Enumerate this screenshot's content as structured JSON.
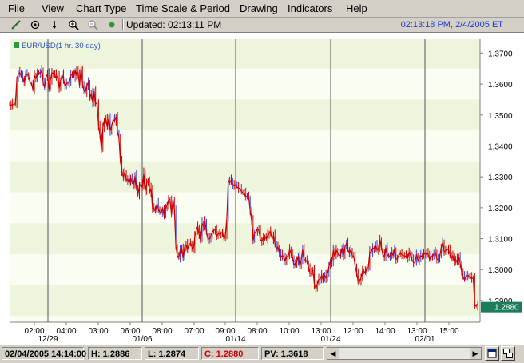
{
  "menu": {
    "items": [
      "File",
      "View",
      "Chart Type",
      "Time Scale & Period",
      "Drawing",
      "Indicators",
      "Help"
    ]
  },
  "toolbar": {
    "tools": [
      "draw-line-icon",
      "crosshair-icon",
      "arrow-down-icon",
      "zoom-in-icon",
      "zoom-out-icon",
      "green-dot-icon"
    ],
    "updated_text": "Updated: 02:13:11 PM",
    "clock_text": "02:13:18 PM, 2/4/2005 ET"
  },
  "chart_data": {
    "type": "line",
    "legend_label": "EUR/USD(1 hr. 30 day)",
    "series_color": "#cc0000",
    "wick_color": "#3a3aee",
    "ylim": [
      1.283,
      1.3745
    ],
    "yticks": [
      "1.3700",
      "1.3600",
      "1.3500",
      "1.3400",
      "1.3300",
      "1.3200",
      "1.3100",
      "1.3000",
      "1.2900"
    ],
    "last_price_label": "1.2880",
    "last_price": 1.288,
    "time_ticks": [
      "02:00",
      "04:00",
      "03:00",
      "06:00",
      "08:00",
      "07:00",
      "09:00",
      "08:00",
      "10:00",
      "13:00",
      "12:00",
      "14:00",
      "13:00",
      "15:00"
    ],
    "date_ticks": [
      "12/29",
      "01/06",
      "01/14",
      "01/24",
      "02/01"
    ],
    "series": [
      {
        "values": [
          1.3535,
          1.3531,
          1.3534,
          1.3533,
          1.3538,
          1.3618,
          1.3632,
          1.3637,
          1.3627,
          1.362,
          1.3605,
          1.3631,
          1.3629,
          1.3629,
          1.3603,
          1.3602,
          1.3582,
          1.3628,
          1.3617,
          1.3635,
          1.3638,
          1.3634,
          1.3644,
          1.3605,
          1.3588,
          1.3623,
          1.3633,
          1.3584,
          1.3613,
          1.3637,
          1.3634,
          1.363,
          1.3617,
          1.3627,
          1.3585,
          1.3613,
          1.363,
          1.3616,
          1.3593,
          1.3602,
          1.3603,
          1.3605,
          1.3628,
          1.3632,
          1.3624,
          1.3645,
          1.3626,
          1.3639,
          1.3593,
          1.3654,
          1.3599,
          1.3579,
          1.3574,
          1.3594,
          1.3607,
          1.3555,
          1.357,
          1.3539,
          1.3577,
          1.3535,
          1.3539,
          1.3464,
          1.3435,
          1.3387,
          1.346,
          1.3485,
          1.3487,
          1.3461,
          1.3491,
          1.3448,
          1.3465,
          1.3485,
          1.3481,
          1.3495,
          1.3446,
          1.3426,
          1.335,
          1.3318,
          1.3299,
          1.3316,
          1.3288,
          1.3293,
          1.328,
          1.3297,
          1.3283,
          1.3275,
          1.3303,
          1.3264,
          1.3242,
          1.3268,
          1.3277,
          1.3264,
          1.3312,
          1.3254,
          1.3279,
          1.3289,
          1.325,
          1.3263,
          1.3196,
          1.32,
          1.3187,
          1.3213,
          1.3195,
          1.3186,
          1.3184,
          1.3197,
          1.3175,
          1.3195,
          1.3209,
          1.3226,
          1.3227,
          1.3177,
          1.3226,
          1.3192,
          1.3076,
          1.3045,
          1.3038,
          1.3063,
          1.3069,
          1.3037,
          1.3074,
          1.3081,
          1.3065,
          1.3081,
          1.3085,
          1.3073,
          1.3064,
          1.3106,
          1.3128,
          1.314,
          1.3111,
          1.3094,
          1.315,
          1.3139,
          1.3158,
          1.3121,
          1.3099,
          1.3099,
          1.3108,
          1.3121,
          1.3127,
          1.3128,
          1.3108,
          1.3115,
          1.3117,
          1.3116,
          1.3121,
          1.3098,
          1.3113,
          1.3167,
          1.3289,
          1.3281,
          1.3289,
          1.3275,
          1.327,
          1.3275,
          1.3266,
          1.3264,
          1.3262,
          1.3252,
          1.3247,
          1.3247,
          1.3236,
          1.3237,
          1.3233,
          1.3191,
          1.3158,
          1.3092,
          1.3119,
          1.3122,
          1.3132,
          1.3125,
          1.3097,
          1.3091,
          1.3103,
          1.3107,
          1.3099,
          1.3112,
          1.3117,
          1.3124,
          1.3098,
          1.3111,
          1.3084,
          1.3065,
          1.3075,
          1.3054,
          1.3039,
          1.3046,
          1.3039,
          1.3028,
          1.3043,
          1.304,
          1.3065,
          1.3052,
          1.304,
          1.3013,
          1.3021,
          1.3025,
          1.3045,
          1.3009,
          1.3033,
          1.3066,
          1.3032,
          1.3031,
          1.3024,
          1.3008,
          1.2988,
          1.2988,
          1.2999,
          1.2953,
          1.2938,
          1.2954,
          1.2968,
          1.2968,
          1.2983,
          1.2966,
          1.2981,
          1.2972,
          1.2986,
          1.3009,
          1.3029,
          1.3023,
          1.3063,
          1.304,
          1.3064,
          1.3054,
          1.3044,
          1.3048,
          1.307,
          1.3046,
          1.3074,
          1.3084,
          1.3064,
          1.3054,
          1.3064,
          1.3045,
          1.3043,
          1.3011,
          1.2989,
          1.2961,
          1.2963,
          1.2974,
          1.2994,
          1.2995,
          1.2989,
          1.3006,
          1.3006,
          1.3057,
          1.3056,
          1.307,
          1.3067,
          1.3078,
          1.3062,
          1.307,
          1.3097,
          1.3071,
          1.3048,
          1.3041,
          1.3072,
          1.3049,
          1.3043,
          1.3045,
          1.3055,
          1.3045,
          1.3066,
          1.3034,
          1.3036,
          1.3047,
          1.3053,
          1.3049,
          1.3045,
          1.3044,
          1.3042,
          1.3038,
          1.3056,
          1.3046,
          1.3031,
          1.3023,
          1.3021,
          1.3049,
          1.3029,
          1.3036,
          1.3045,
          1.3041,
          1.305,
          1.3053,
          1.3048,
          1.3052,
          1.3031,
          1.3045,
          1.3042,
          1.3052,
          1.3055,
          1.3035,
          1.3032,
          1.3043,
          1.3071,
          1.3088,
          1.3057,
          1.3061,
          1.3066,
          1.3064,
          1.3048,
          1.3035,
          1.3046,
          1.3026,
          1.3033,
          1.3022,
          1.3042,
          1.3021,
          1.2993,
          1.2977,
          1.2966,
          1.2978,
          1.2981,
          1.2979,
          1.2974,
          1.2972,
          1.2972,
          1.2883,
          1.2883,
          1.2888
        ]
      }
    ]
  },
  "status": {
    "datetime": "02/04/2005 14:14:00",
    "high": "H: 1.2886",
    "low": "L: 1.2874",
    "close": "C: 1.2880",
    "pv": "PV: 1.3618"
  }
}
